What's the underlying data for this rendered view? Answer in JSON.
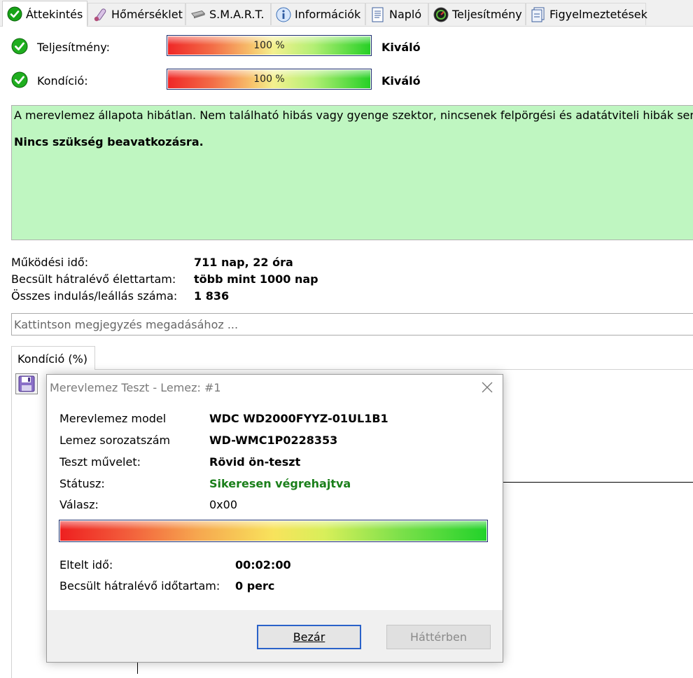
{
  "tabs": [
    {
      "label": "Áttekintés",
      "icon": "check-circle-icon",
      "active": true
    },
    {
      "label": "Hőmérséklet",
      "icon": "thermometer-icon"
    },
    {
      "label": "S.M.A.R.T.",
      "icon": "hard-disk-icon"
    },
    {
      "label": "Információk",
      "icon": "info-icon"
    },
    {
      "label": "Napló",
      "icon": "log-document-icon"
    },
    {
      "label": "Teljesítmény",
      "icon": "performance-gauge-icon"
    },
    {
      "label": "Figyelmeztetések",
      "icon": "alerts-document-icon"
    }
  ],
  "status": {
    "performance": {
      "label": "Teljesítmény:",
      "percent_text": "100 %",
      "level": 1.0,
      "verdict": "Kiváló"
    },
    "health": {
      "label": "Kondíció:",
      "percent_text": "100 %",
      "level": 1.0,
      "verdict": "Kiváló"
    }
  },
  "message": {
    "text": "A merevlemez állapota hibátlan. Nem található hibás vagy gyenge szektor, nincsenek felpörgési és adatátviteli hibák sem.",
    "action": "Nincs szükség beavatkozásra.",
    "background": "#bff6c1"
  },
  "stats": [
    {
      "label": "Működési idő:",
      "value": "711 nap, 22 óra"
    },
    {
      "label": "Becsült hátralévő élettartam:",
      "value": "több mint 1000 nap"
    },
    {
      "label": "Összes indulás/leállás száma:",
      "value": "1 836"
    }
  ],
  "note": {
    "placeholder": "Kattintson megjegyzés megadásához ..."
  },
  "chart_tab": {
    "label": "Kondíció  (%)"
  },
  "dialog": {
    "title": "Merevlemez Teszt - Lemez: #1",
    "fields": [
      {
        "label": "Merevlemez model",
        "value": "WDC WD2000FYYZ-01UL1B1"
      },
      {
        "label": "Lemez sorozatszám",
        "value": "WD-WMC1P0228353"
      },
      {
        "label": "Teszt művelet:",
        "value": "Rövid ön-teszt"
      },
      {
        "label": "Státusz:",
        "value": "Sikeresen végrehajtva",
        "color": "#1a7f1a"
      },
      {
        "label": "Válasz:",
        "value": "0x00"
      }
    ],
    "progress": 1.0,
    "elapsed": {
      "label": "Eltelt idő:",
      "value": "00:02:00"
    },
    "remaining": {
      "label": "Becsült hátralévő időtartam:",
      "value": "0 perc"
    },
    "buttons": {
      "close": "Bezár",
      "background": "Háttérben"
    }
  }
}
